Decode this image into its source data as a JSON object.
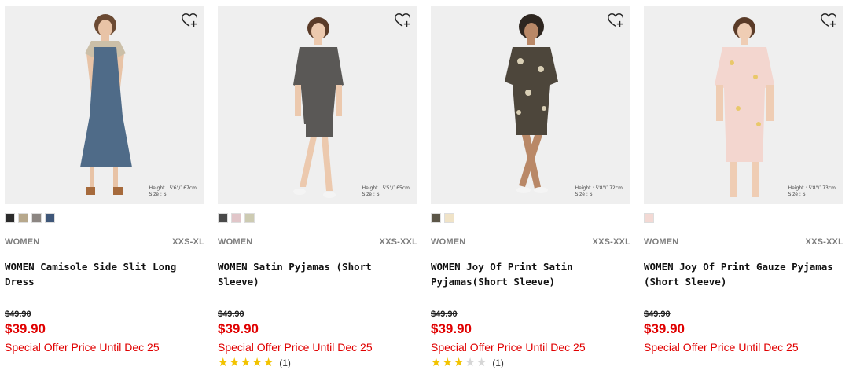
{
  "products": [
    {
      "category": "WOMEN",
      "sizes": "XXS-XL",
      "name": "WOMEN Camisole Side Slit Long Dress",
      "original_price": "$49.90",
      "price": "$39.90",
      "offer": "Special Offer Price Until Dec 25",
      "model_height": "Height : 5'6\"/167cm",
      "model_size": "Size : S",
      "swatches": [
        "#2b2b2b",
        "#b7a88c",
        "#8c8682",
        "#3f5779"
      ],
      "rating": null
    },
    {
      "category": "WOMEN",
      "sizes": "XXS-XXL",
      "name": "WOMEN Satin Pyjamas (Short Sleeve)",
      "original_price": "$49.90",
      "price": "$39.90",
      "offer": "Special Offer Price Until Dec 25",
      "model_height": "Height : 5'5\"/165cm",
      "model_size": "Size : S",
      "swatches": [
        "#4a4a4a",
        "#e1c6c9",
        "#cdcbb2"
      ],
      "rating": {
        "stars": 5,
        "count": "(1)"
      }
    },
    {
      "category": "WOMEN",
      "sizes": "XXS-XXL",
      "name": "WOMEN Joy Of Print Satin Pyjamas(Short Sleeve)",
      "original_price": "$49.90",
      "price": "$39.90",
      "offer": "Special Offer Price Until Dec 25",
      "model_height": "Height : 5'8\"/172cm",
      "model_size": "Size : S",
      "swatches": [
        "#5c5648",
        "#f0e3c7"
      ],
      "rating": {
        "stars": 3,
        "count": "(1)"
      }
    },
    {
      "category": "WOMEN",
      "sizes": "XXS-XXL",
      "name": "WOMEN Joy Of Print Gauze Pyjamas (Short Sleeve)",
      "original_price": "$49.90",
      "price": "$39.90",
      "offer": "Special Offer Price Until Dec 25",
      "model_height": "Height : 5'8\"/173cm",
      "model_size": "Size : S",
      "swatches": [
        "#f3d9d4"
      ],
      "rating": null
    }
  ],
  "colors": {
    "sale_red": "#e00000",
    "star_yellow": "#f2c300",
    "image_bg": "#efefef"
  },
  "icons": {
    "wishlist": "heart-plus-icon",
    "star": "star-icon"
  }
}
